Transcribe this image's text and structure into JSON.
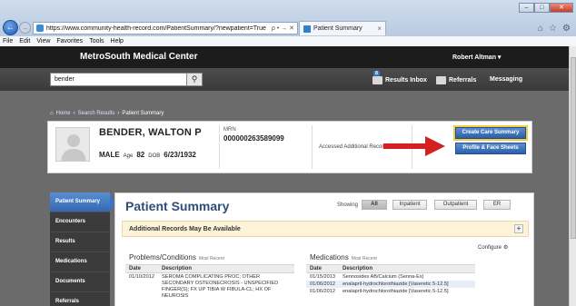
{
  "browser": {
    "url": "https://www.community-health-record.com/PatientSummary/?newpatient=True",
    "address_tools": "ρ • → ✕",
    "tab_title": "Patient Summary",
    "menu": [
      "File",
      "Edit",
      "View",
      "Favorites",
      "Tools",
      "Help"
    ]
  },
  "app": {
    "title": "MetroSouth Medical Center",
    "user": "Robert Altman ▾",
    "search_value": "bender",
    "results_inbox": "Results Inbox",
    "referrals": "Referrals",
    "messaging": "Messaging",
    "inbox_count": "8"
  },
  "breadcrumb": {
    "home": "Home",
    "search_results": "Search Results",
    "current": "Patient Summary",
    "sep": "›"
  },
  "patient": {
    "name": "BENDER, WALTON P",
    "gender": "MALE",
    "age_label": "Age",
    "age": "82",
    "dob_label": "DOB",
    "dob": "6/23/1932",
    "mrn_label": "MRN",
    "mrn": "000000263589099",
    "accessed": "Accessed Additional Records"
  },
  "actions": {
    "create_care_summary": "Create Care Summary",
    "profile_face_sheets": "Profile & Face Sheets"
  },
  "nav": [
    "Patient Summary",
    "Encounters",
    "Results",
    "Medications",
    "Documents",
    "Referrals"
  ],
  "summary": {
    "title": "Patient Summary",
    "showing": "Showing",
    "filters": [
      "All",
      "Inpatient",
      "Outpatient",
      "ER"
    ],
    "notice": "Additional Records May Be Available",
    "configure": "Configure"
  },
  "problems": {
    "title": "Problems/Conditions",
    "sub": "Most Recent",
    "headers": [
      "Date",
      "Description"
    ],
    "rows": [
      {
        "date": "01/10/2012",
        "desc": "SEROMA COMPLICATING PROC; OTHER SECONDARY OSTEONECROSIS - UNSPECIFIED FINGER(S); FX UP TIBIA W FIBULA-CL; HX OF NEUROSIS"
      }
    ]
  },
  "medications": {
    "title": "Medications",
    "sub": "Most Recent",
    "headers": [
      "Date",
      "Description"
    ],
    "rows": [
      {
        "date": "01/15/2013",
        "desc": "Sennosides AB/Calcium (Senna-Ex)"
      },
      {
        "date": "01/06/2012",
        "desc": "enalapril-hydrochlorothiazide [Vaseretic 5-12.5]"
      },
      {
        "date": "01/06/2012",
        "desc": "enalapril-hydrochlorothiazide [Vaseretic 5-12.5]"
      }
    ]
  },
  "colors": {
    "accent_blue": "#3368b4",
    "arrow_red": "#d42020",
    "highlight": "#f2cc3c"
  }
}
